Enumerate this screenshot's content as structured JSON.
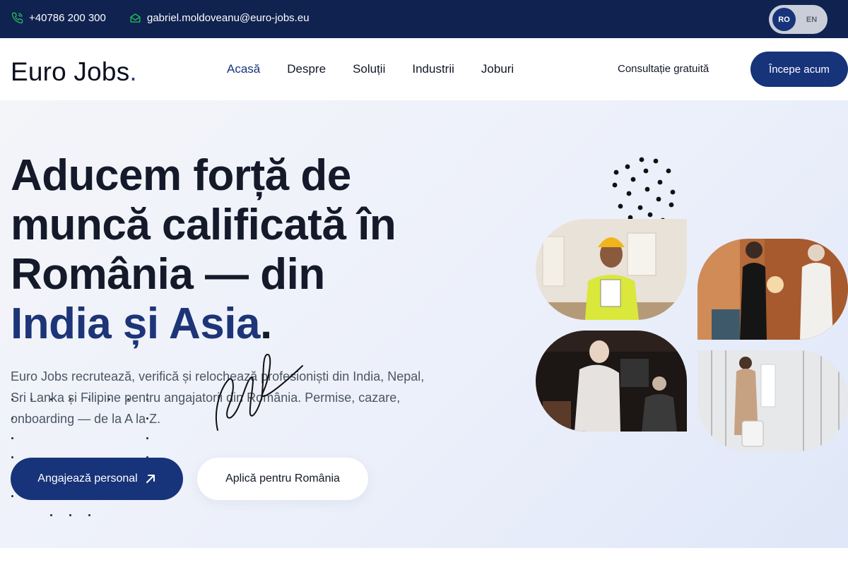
{
  "topbar": {
    "phone": "+40786 200 300",
    "email": "gabriel.moldoveanu@euro-jobs.eu",
    "lang": {
      "ro": "RO",
      "en": "EN",
      "selected": "RO"
    }
  },
  "header": {
    "logo_text": "Euro Jobs",
    "logo_dot": ".",
    "nav": [
      "Acasă",
      "Despre",
      "Soluții",
      "Industrii",
      "Joburi"
    ],
    "active_nav": "Acasă",
    "consult_label": "Consultație gratuită",
    "start_label": "Începe acum"
  },
  "hero": {
    "title_line1": "Aducem forță de",
    "title_line2": "muncă calificată în",
    "title_line3": "România — din",
    "title_accent": "India și Asia",
    "title_end": ".",
    "description": "Euro Jobs recrutează, verifică și relochează profesioniști din India, Nepal, Sri Lanka și Filipine pentru angajatorii din România. Permise, cazare, onboarding — de la A la Z.",
    "primary_button": "Angajează personal",
    "secondary_button": "Aplică pentru România"
  },
  "colors": {
    "navy": "#0f2250",
    "brand": "#17337a",
    "accent_text": "#1d3578"
  },
  "icons": {
    "phone": "phone-icon",
    "email": "envelope-icon",
    "arrow": "arrow-up-right-icon"
  }
}
